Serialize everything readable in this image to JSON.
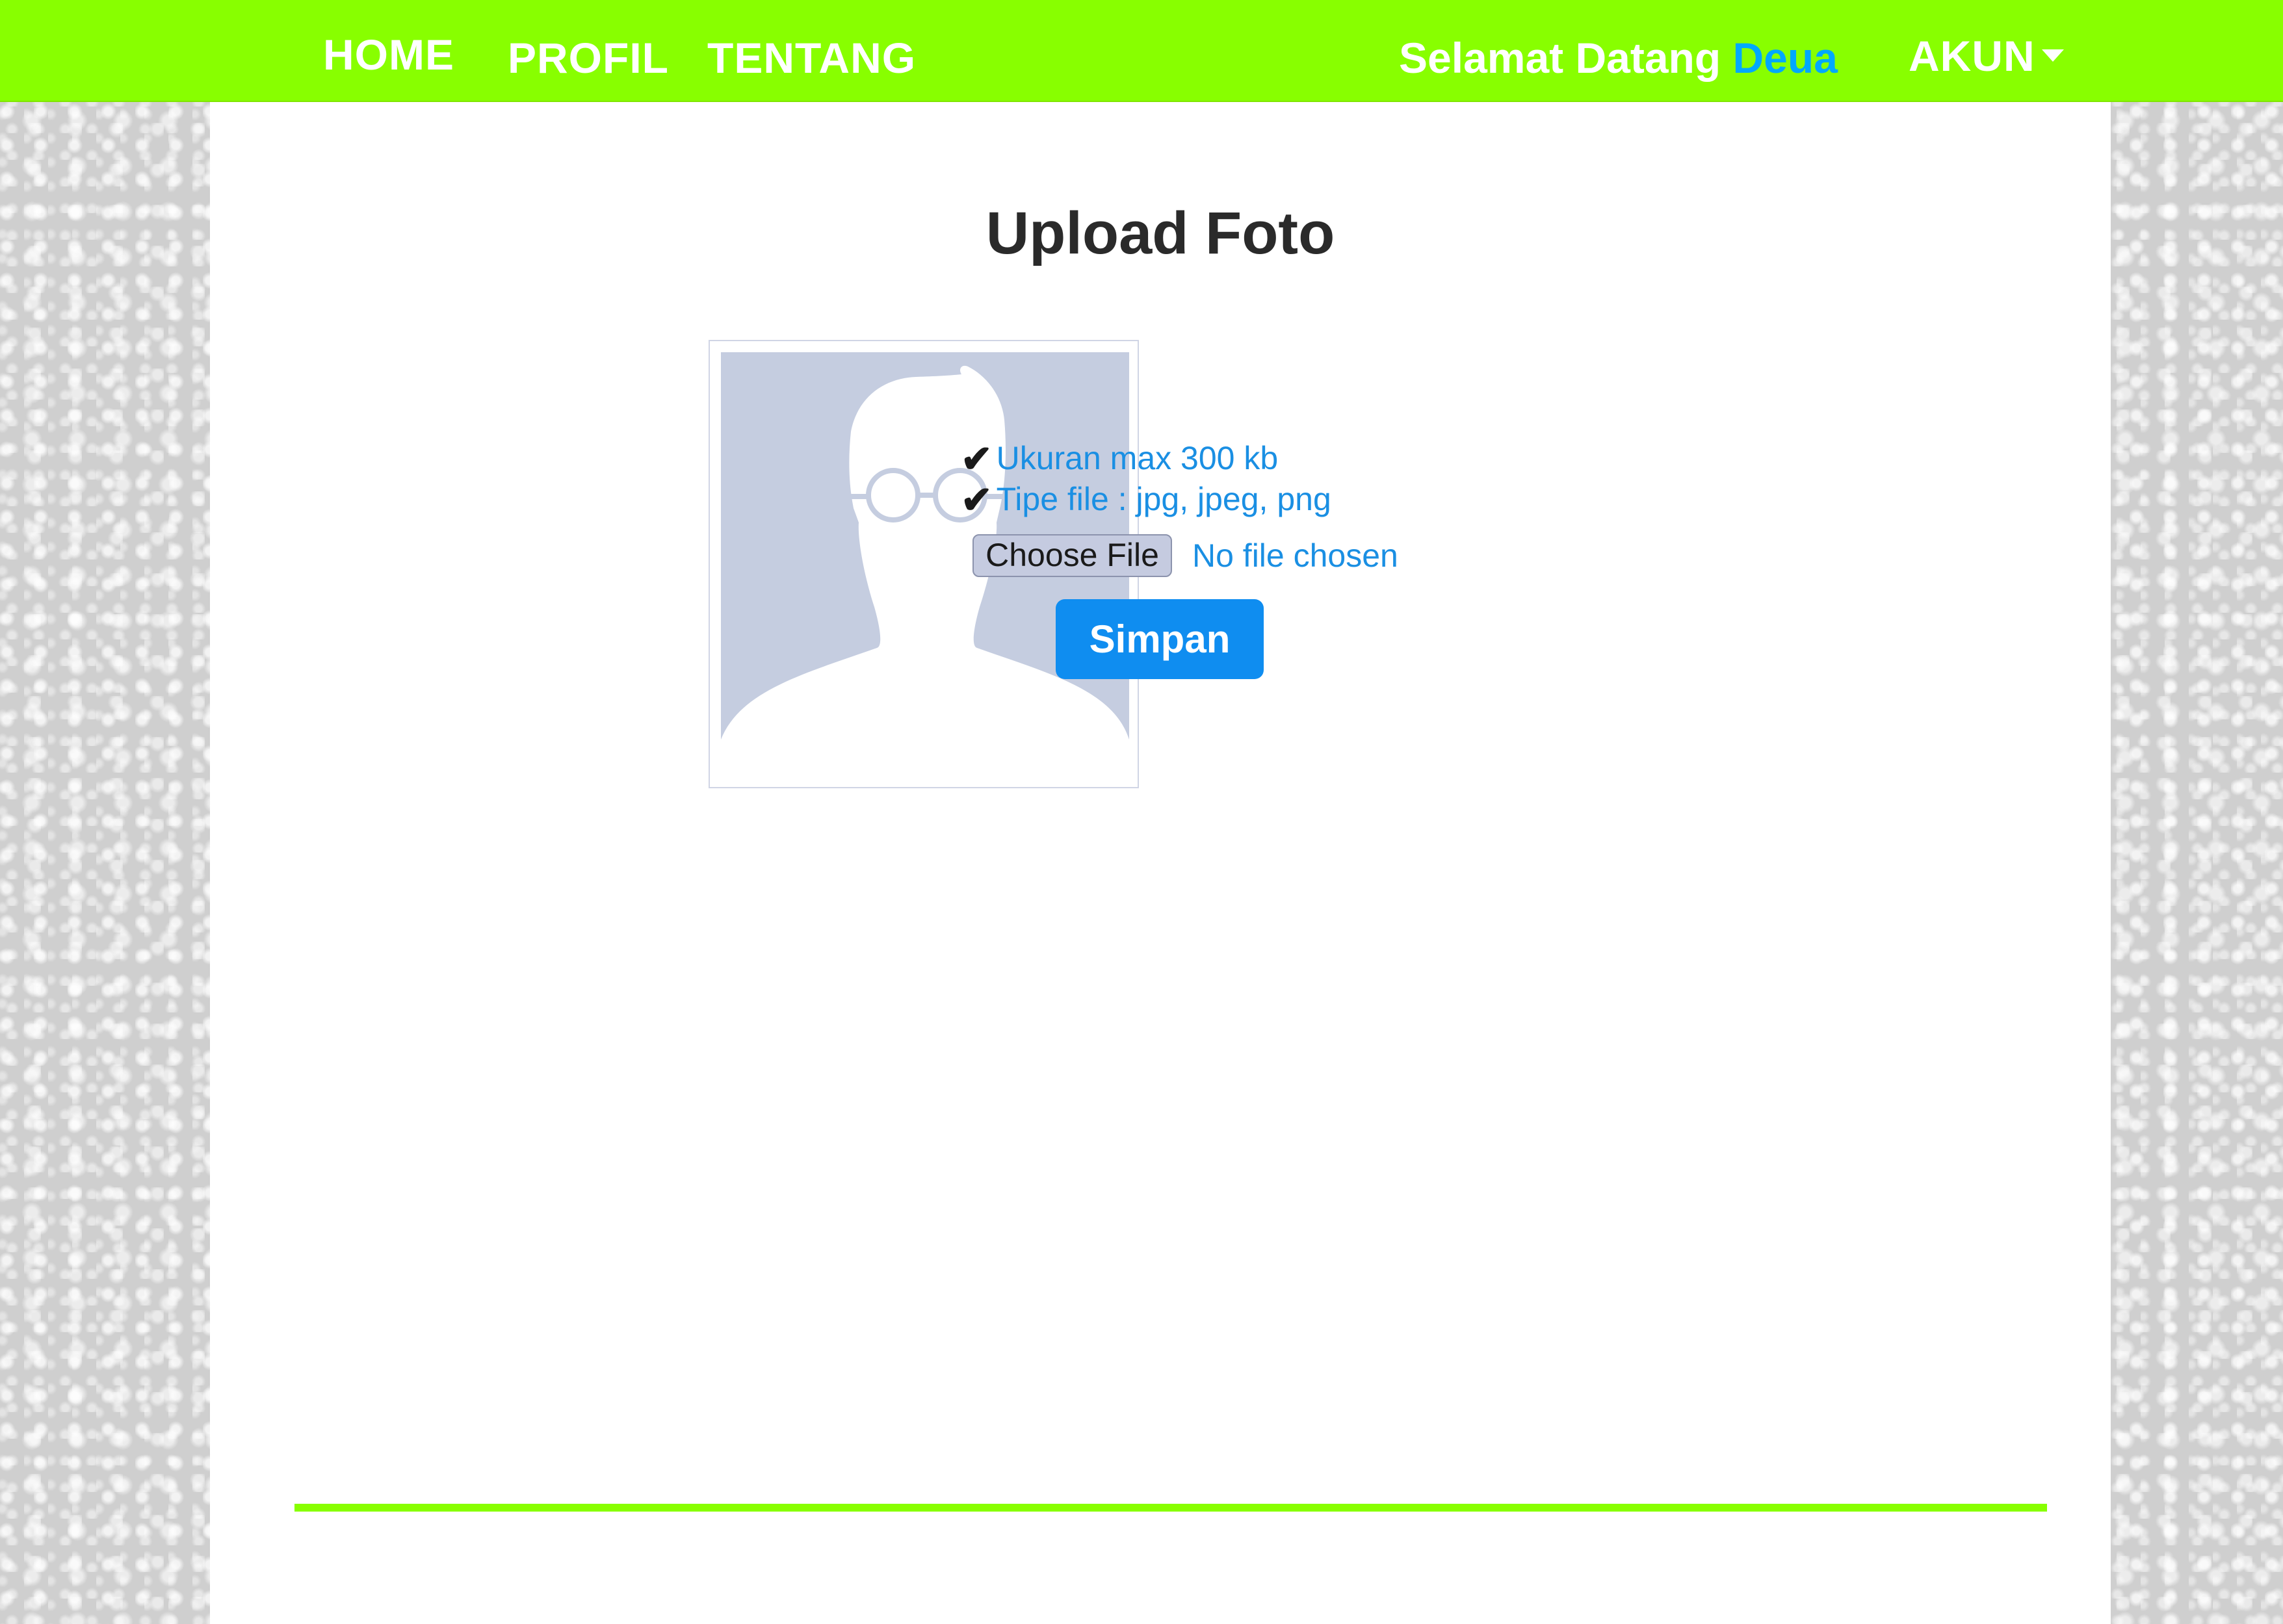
{
  "nav": {
    "home": "HOME",
    "profil": "PROFIL",
    "tentang": "TENTANG",
    "welcome_prefix": "Selamat Datang",
    "username": "Deua",
    "account": "AKUN"
  },
  "main": {
    "title": "Upload Foto",
    "requirements": [
      "Ukuran max 300 kb",
      "Tipe file : jpg, jpeg, png"
    ],
    "check_glyph": "✔",
    "file_button": "Choose File",
    "file_status": "No file chosen",
    "save_button": "Simpan"
  },
  "icons": {
    "avatar": "default-avatar-placeholder",
    "account_caret": "caret-down-icon",
    "check": "check-icon"
  },
  "colors": {
    "navbar": "#88ff00",
    "accent": "#1a8fe3",
    "username": "#00a8ff",
    "button": "#0f8df0",
    "avatar_bg": "#c5cde0"
  }
}
